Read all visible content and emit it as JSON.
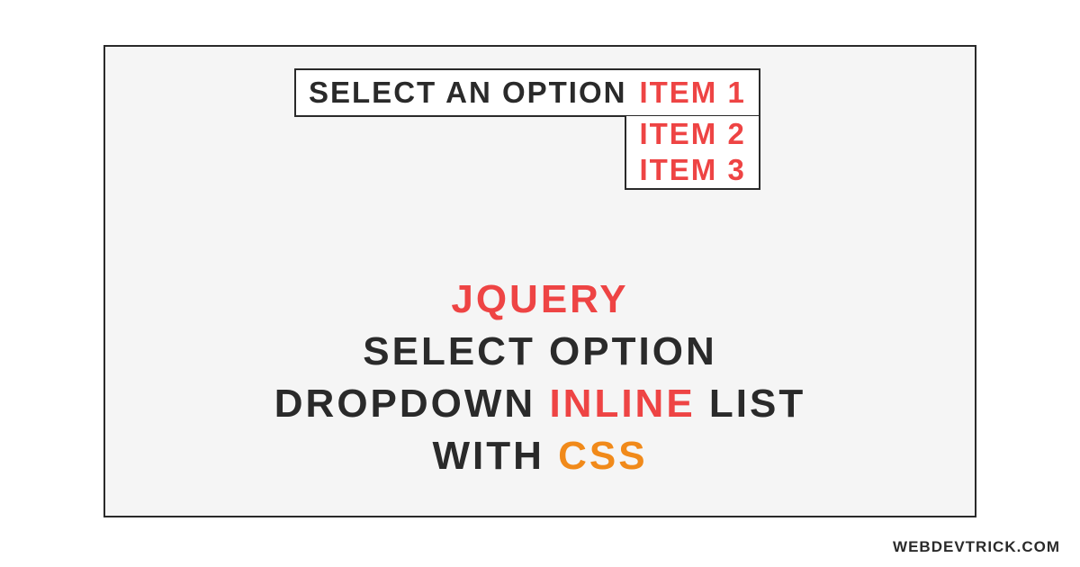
{
  "dropdown": {
    "label": "SELECT AN OPTION",
    "selected": "ITEM 1",
    "items": [
      "ITEM 2",
      "ITEM 3"
    ]
  },
  "title": {
    "w1": "JQUERY",
    "w2": "SELECT OPTION",
    "w3a": "DROPDOWN",
    "w3b": "INLINE",
    "w3c": "LIST",
    "w4a": "WITH",
    "w4b": "CSS"
  },
  "watermark": "WEBDEVTRICK.COM",
  "colors": {
    "dark": "#2a2a2a",
    "red": "#ee4444",
    "orange": "#f18a1a",
    "bg": "#f5f5f5"
  }
}
